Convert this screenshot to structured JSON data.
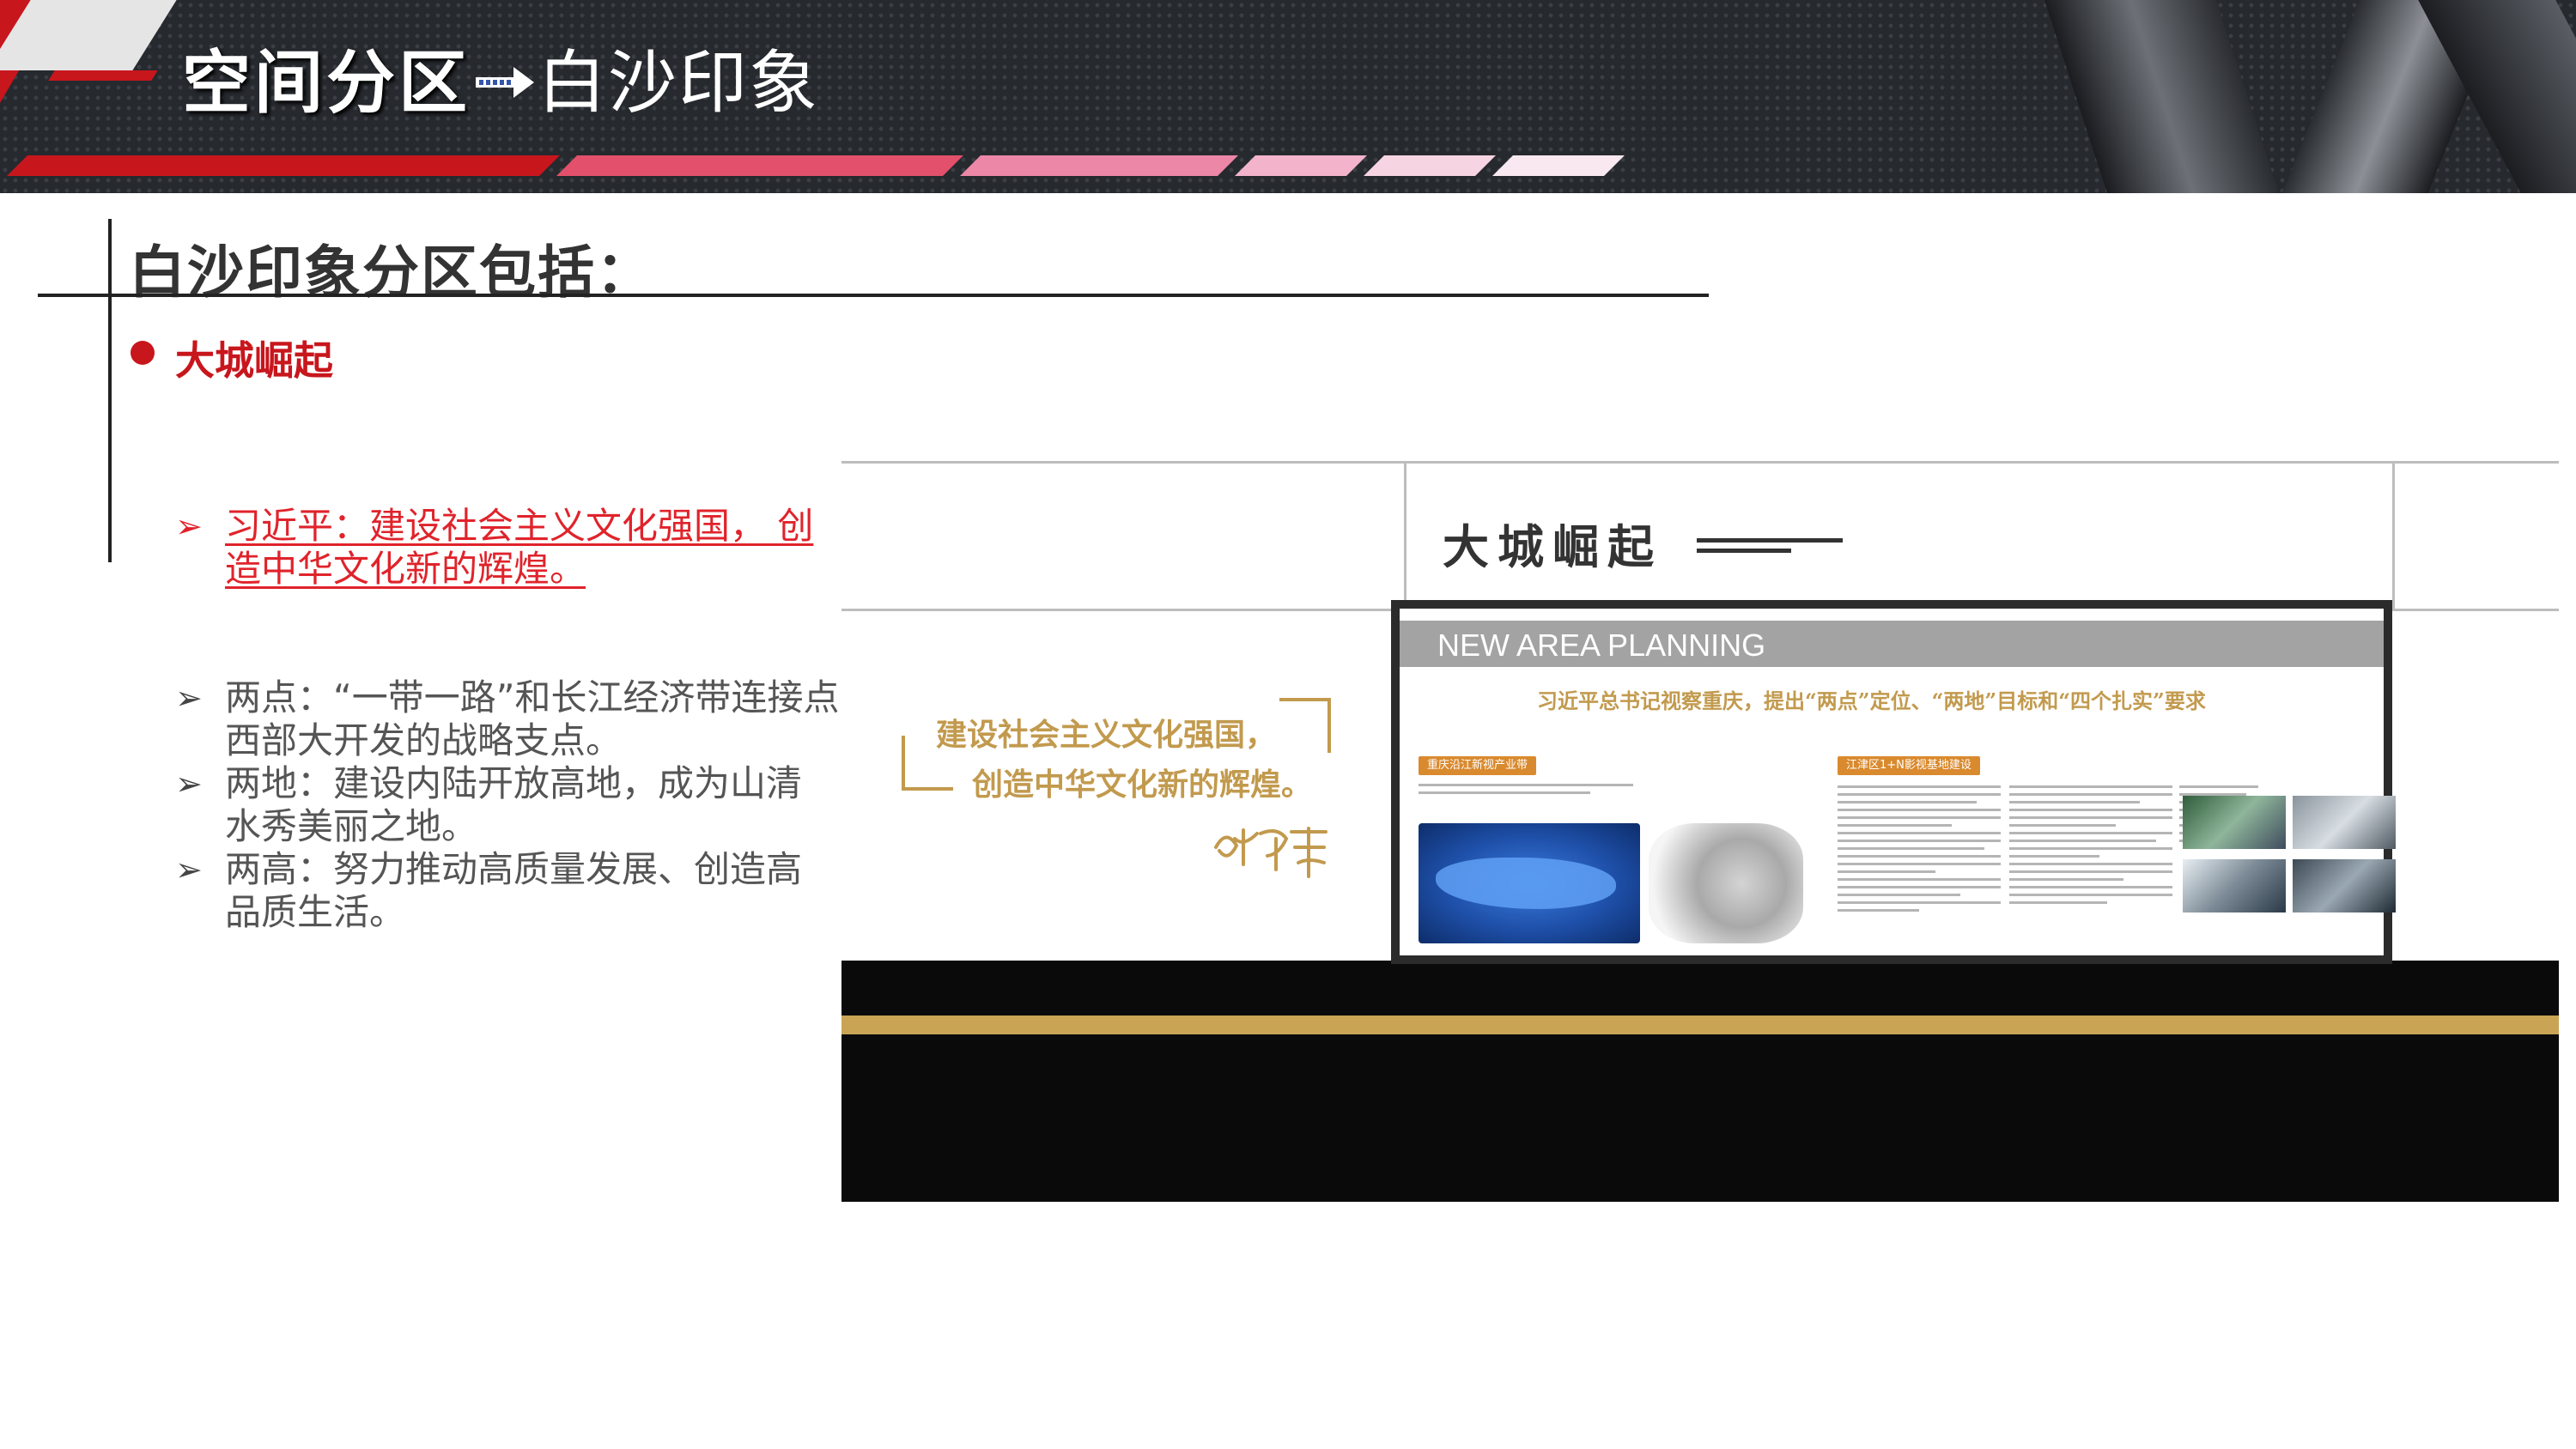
{
  "header": {
    "title_main": "空间分区",
    "title_sub": "白沙印象",
    "stripe_colors": [
      "#c8161d",
      "#e2506b",
      "#ec87a8",
      "#f2b3cb",
      "#f6d4e1",
      "#f9e8ef"
    ]
  },
  "section": {
    "title": "白沙印象分区包括：",
    "subtitle": "大城崛起",
    "accent_color": "#c8161d"
  },
  "items": [
    {
      "marker": "➢",
      "lines": [
        "习近平：建设社会主义文化强国， 创",
        "造中华文化新的辉煌。"
      ],
      "style": "red"
    },
    {
      "marker": "➢",
      "lines": [
        "两点：“一带一路”和长江经济带连接点，",
        "西部大开发的战略支点。"
      ],
      "style": "normal"
    },
    {
      "marker": "➢",
      "lines": [
        "两地：建设内陆开放高地，成为山清",
        "水秀美丽之地。"
      ],
      "style": "normal"
    },
    {
      "marker": "➢",
      "lines": [
        "两高：努力推动高质量发展、创造高",
        "品质生活。"
      ],
      "style": "normal"
    }
  ],
  "render": {
    "heading": "大城崛起",
    "quote_line1": "建设社会主义文化强国，",
    "quote_line2": "创造中华文化新的辉煌。",
    "board_bar": "NEW AREA PLANNING",
    "board_subtitle": "习近平总书记视察重庆，提出“两点”定位、“两地”目标和“四个扎实”要求",
    "tag_1": "重庆沿江新视产业带",
    "tag_2": "江津区1+N影视基地建设",
    "gold_color": "#c9a455"
  }
}
